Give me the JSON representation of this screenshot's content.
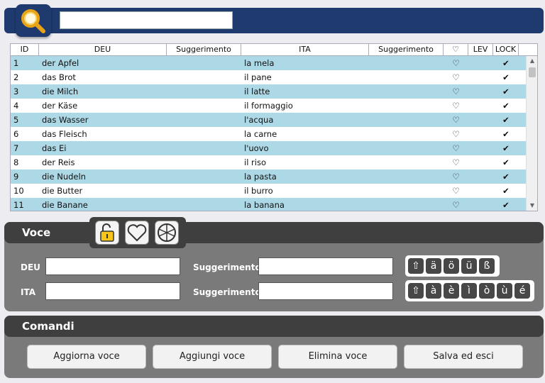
{
  "search": {
    "value": "",
    "placeholder": ""
  },
  "table": {
    "headers": {
      "id": "ID",
      "deu": "DEU",
      "sug1": "Suggerimento",
      "ita": "ITA",
      "sug2": "Suggerimento",
      "heart": "♡",
      "lev": "LEV",
      "lock": "LOCK"
    },
    "rows": [
      {
        "id": "1",
        "deu": "der Apfel",
        "ita": "la mela",
        "heart": "♡",
        "lock": "✔"
      },
      {
        "id": "2",
        "deu": "das Brot",
        "ita": "il pane",
        "heart": "♡",
        "lock": "✔"
      },
      {
        "id": "3",
        "deu": "die Milch",
        "ita": "il latte",
        "heart": "♡",
        "lock": "✔"
      },
      {
        "id": "4",
        "deu": "der Käse",
        "ita": "il formaggio",
        "heart": "♡",
        "lock": "✔"
      },
      {
        "id": "5",
        "deu": "das Wasser",
        "ita": "l'acqua",
        "heart": "♡",
        "lock": "✔"
      },
      {
        "id": "6",
        "deu": "das Fleisch",
        "ita": "la carne",
        "heart": "♡",
        "lock": "✔"
      },
      {
        "id": "7",
        "deu": "das Ei",
        "ita": "l'uovo",
        "heart": "♡",
        "lock": "✔"
      },
      {
        "id": "8",
        "deu": "der Reis",
        "ita": "il riso",
        "heart": "♡",
        "lock": "✔"
      },
      {
        "id": "9",
        "deu": "die Nudeln",
        "ita": "la pasta",
        "heart": "♡",
        "lock": "✔"
      },
      {
        "id": "10",
        "deu": "die Butter",
        "ita": "il burro",
        "heart": "♡",
        "lock": "✔"
      },
      {
        "id": "11",
        "deu": "die Banane",
        "ita": "la banana",
        "heart": "♡",
        "lock": "✔"
      }
    ]
  },
  "voce": {
    "title": "Voce",
    "deu_label": "DEU",
    "ita_label": "ITA",
    "sug_label_1": "Suggerimento",
    "sug_label_2": "Suggerimento",
    "deu_chars": [
      "⇧",
      "ä",
      "ö",
      "ü",
      "ß"
    ],
    "ita_chars": [
      "⇧",
      "à",
      "è",
      "ì",
      "ò",
      "ù",
      "é"
    ]
  },
  "comandi": {
    "title": "Comandi",
    "update": "Aggiorna voce",
    "add": "Aggiungi voce",
    "delete": "Elimina voce",
    "save": "Salva ed esci"
  },
  "icons": [
    "search-icon",
    "unlock-icon",
    "heart-icon",
    "wheel-icon"
  ],
  "colors": {
    "header_bar": "#1f3a6e",
    "row_alt": "#add8e6",
    "panel_dark": "#3f3f3f",
    "panel": "#7a7a7a",
    "lock_yellow": "#f5c518"
  }
}
